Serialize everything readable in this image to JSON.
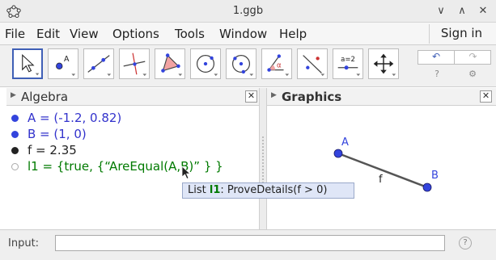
{
  "window": {
    "title": "1.ggb",
    "logo_icon": "geogebra-logo-icon",
    "minimize_glyph": "∨",
    "maximize_glyph": "∧",
    "close_glyph": "✕"
  },
  "menu": {
    "items": [
      "File",
      "Edit",
      "View",
      "Options",
      "Tools",
      "Window",
      "Help"
    ],
    "sign_in": "Sign in"
  },
  "toolbar": {
    "tools": [
      {
        "icon": "move-arrow-icon"
      },
      {
        "icon": "point-icon",
        "label": "A"
      },
      {
        "icon": "line-icon"
      },
      {
        "icon": "perpendicular-line-icon"
      },
      {
        "icon": "polygon-icon"
      },
      {
        "icon": "circle-center-point-icon"
      },
      {
        "icon": "circle-three-points-icon"
      },
      {
        "icon": "angle-icon",
        "label": "α"
      },
      {
        "icon": "reflect-icon"
      },
      {
        "icon": "slider-icon",
        "label": "a=2"
      },
      {
        "icon": "move-graphics-icon"
      }
    ],
    "undo_glyph": "↶",
    "redo_glyph": "↷",
    "help_glyph": "?",
    "settings_glyph": "⚙"
  },
  "algebra": {
    "title": "Algebra",
    "rows": [
      {
        "text": "A = (-1.2, 0.82)",
        "color": "#3333cc",
        "filled": true
      },
      {
        "text": "B = (1, 0)",
        "color": "#3333cc",
        "filled": true
      },
      {
        "text": "f = 2.35",
        "color": "#222222",
        "filled": true
      },
      {
        "text": "l1 = {true, {“AreEqual(A,B)” } }",
        "color": "#007a00",
        "filled": false
      }
    ]
  },
  "graphics": {
    "title": "Graphics",
    "point_a_label": "A",
    "point_b_label": "B",
    "segment_label": "f",
    "point_color": "#3344dd"
  },
  "tooltip": {
    "prefix": "List ",
    "name": "l1",
    "rest": ": ProveDetails(f > 0)"
  },
  "input_bar": {
    "label": "Input:",
    "value": "",
    "placeholder": "",
    "help_glyph": "?"
  }
}
